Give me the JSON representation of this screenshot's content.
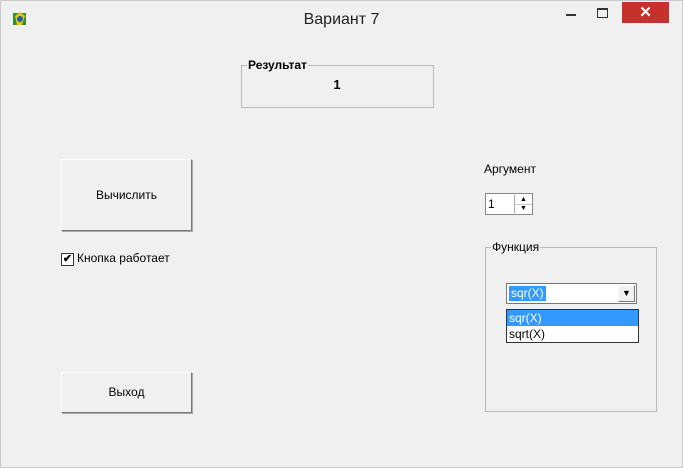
{
  "window": {
    "title": "Вариант 7",
    "close_glyph": "✕"
  },
  "result": {
    "label": "Результат",
    "value": "1"
  },
  "buttons": {
    "calculate": "Вычислить",
    "exit": "Выход"
  },
  "checkbox": {
    "label": "Кнопка работает",
    "checked": true,
    "glyph": "✔"
  },
  "argument": {
    "label": "Аргумент",
    "value": "1",
    "up_glyph": "▲",
    "down_glyph": "▼"
  },
  "function": {
    "label": "Функция",
    "selected": "sqr(X)",
    "arrow_glyph": "▼",
    "options": [
      "sqr(X)",
      "sqrt(X)"
    ]
  },
  "colors": {
    "close": "#c7312b",
    "selection": "#3399ff"
  }
}
